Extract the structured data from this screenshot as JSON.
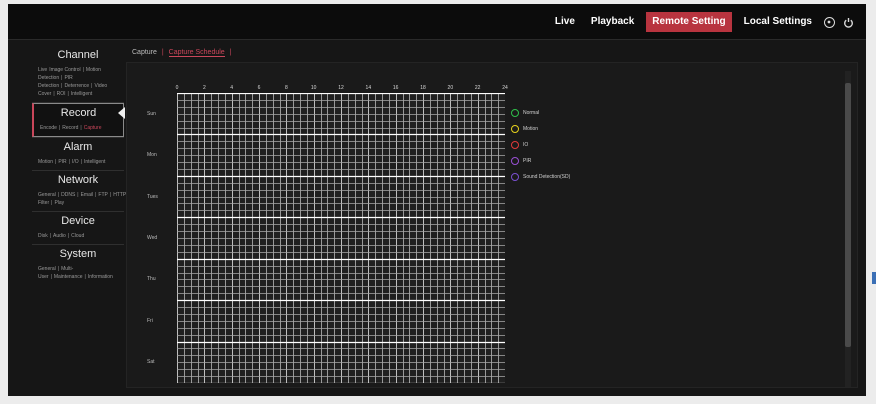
{
  "nav": {
    "live": "Live",
    "playback": "Playback",
    "remote": "Remote Setting",
    "local": "Local Settings",
    "accent_color": "#b8343f"
  },
  "sidebar": {
    "groups": [
      {
        "title": "Channel",
        "items": [
          "Live",
          "Image Control",
          "|",
          "Motion Detection",
          "|",
          "PIR Detection",
          "|",
          "Deterrence",
          "|",
          "Video Cover",
          "|",
          "ROI",
          "|",
          "Intelligent"
        ]
      },
      {
        "title": "Record",
        "items": [
          "Encode",
          "|",
          "Record",
          "|",
          "Capture"
        ],
        "active": true,
        "highlight": "Capture"
      },
      {
        "title": "Alarm",
        "items": [
          "Motion",
          "|",
          "PIR",
          "|",
          "I/O",
          "|",
          "Intelligent"
        ]
      },
      {
        "title": "Network",
        "items": [
          "General",
          "|",
          "DDNS",
          "|",
          "Email",
          "|",
          "FTP",
          "|",
          "HTTPS",
          "|",
          "IP Filter",
          "|",
          "Play"
        ]
      },
      {
        "title": "Device",
        "items": [
          "Disk",
          "|",
          "Audio",
          "|",
          "Cloud"
        ]
      },
      {
        "title": "System",
        "items": [
          "General",
          "|",
          "Multi-User",
          "|",
          "Maintenance",
          "|",
          "Information"
        ]
      }
    ]
  },
  "tabs": {
    "capture": "Capture",
    "sep": "|",
    "schedule": "Capture Schedule",
    "sep2": "|"
  },
  "schedule": {
    "hours": [
      "0",
      "2",
      "4",
      "6",
      "8",
      "10",
      "12",
      "14",
      "16",
      "18",
      "20",
      "22",
      "24"
    ],
    "days": [
      "Sun",
      "Mon",
      "Tues",
      "Wed",
      "Thu",
      "Fri",
      "Sat"
    ]
  },
  "legend": [
    {
      "label": "Normal",
      "color": "#2fbf4a"
    },
    {
      "label": "Motion",
      "color": "#e6d21c"
    },
    {
      "label": "IO",
      "color": "#e03a3a"
    },
    {
      "label": "PIR",
      "color": "#9a4fd6"
    },
    {
      "label": "Sound Detection(SD)",
      "color": "#7a4fd0"
    }
  ]
}
